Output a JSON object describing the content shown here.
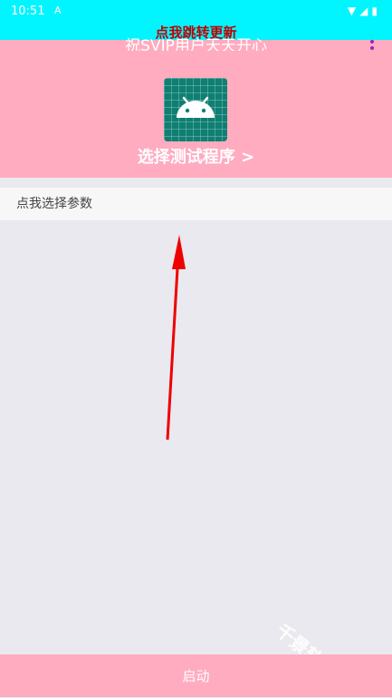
{
  "status_bar": {
    "time": "10:51",
    "notification_icon": "A",
    "icons": [
      "wifi-icon",
      "signal-icon",
      "battery-icon"
    ]
  },
  "update_banner": "点我跳转更新",
  "header": {
    "title": "祝SVIP用户天天开心",
    "app_icon": "android-icon",
    "select_program_label": "选择测试程序 >"
  },
  "param_row_label": "点我选择参数",
  "watermark": "千景软件站",
  "start_button_label": "启动",
  "colors": {
    "status_bar": "#00f5ff",
    "header": "#ffabc0",
    "banner_text": "#c00000",
    "background": "#e9e9ef",
    "arrow": "#ee0000"
  }
}
